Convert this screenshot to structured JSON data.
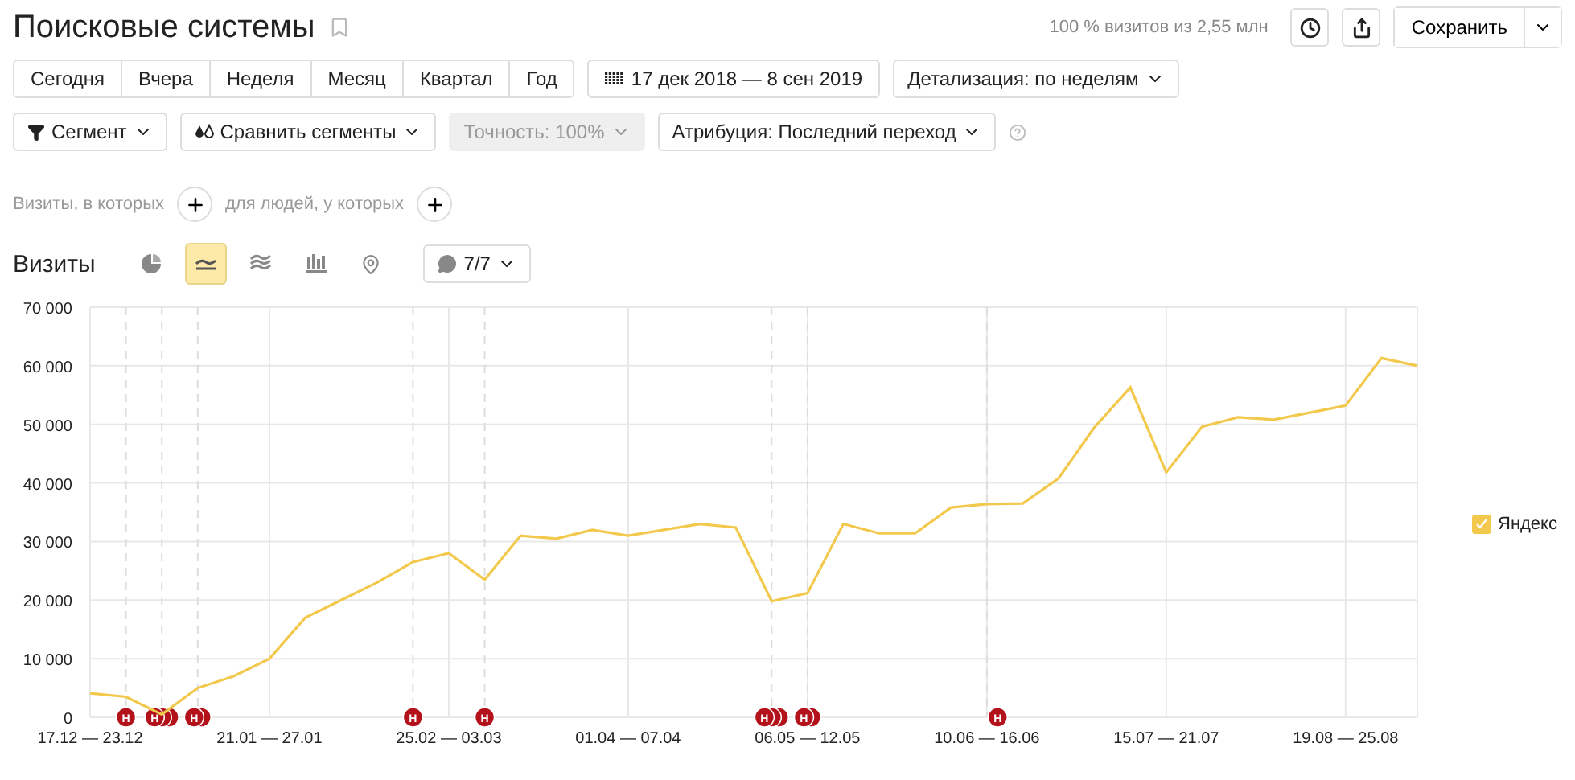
{
  "title": "Поисковые системы",
  "sample_info": "100 % визитов из 2,55 млн",
  "save_button": "Сохранить",
  "periods": [
    {
      "label": "Сегодня",
      "selected": false
    },
    {
      "label": "Вчера",
      "selected": false
    },
    {
      "label": "Неделя",
      "selected": false
    },
    {
      "label": "Месяц",
      "selected": false
    },
    {
      "label": "Квартал",
      "selected": false
    },
    {
      "label": "Год",
      "selected": false
    }
  ],
  "date_range": "17 дек 2018 — 8 сен 2019",
  "detail_dropdown": "Детализация: по неделям",
  "filters": [
    {
      "kind": "segment",
      "label": "Сегмент",
      "disabled": false
    },
    {
      "kind": "compare",
      "label": "Сравнить сегменты",
      "disabled": false
    },
    {
      "kind": "plain",
      "label": "Точность: 100%",
      "disabled": true
    },
    {
      "kind": "plain",
      "label": "Атрибуция: Последний переход",
      "disabled": false
    }
  ],
  "conditions": [
    {
      "label": "Визиты, в которых"
    },
    {
      "label": "для людей, у которых"
    }
  ],
  "metric_title": "Визиты",
  "chart_types": [
    {
      "kind": "pie",
      "selected": false
    },
    {
      "kind": "line",
      "selected": true
    },
    {
      "kind": "area",
      "selected": false
    },
    {
      "kind": "bar",
      "selected": false
    },
    {
      "kind": "map",
      "selected": false
    }
  ],
  "notes_dropdown": "7/7",
  "legend": [
    {
      "checked": true
    }
  ],
  "chart_data": {
    "type": "line",
    "categories": [
      "17.12 — 23.12",
      null,
      null,
      null,
      null,
      "21.01 — 27.01",
      null,
      null,
      null,
      null,
      "25.02 — 03.03",
      null,
      null,
      null,
      null,
      "01.04 — 07.04",
      null,
      null,
      null,
      null,
      "06.05 — 12.05",
      null,
      null,
      null,
      null,
      "10.06 — 16.06",
      null,
      null,
      null,
      null,
      "15.07 — 21.07",
      null,
      null,
      null,
      null,
      "19.08 — 25.08",
      null,
      null
    ],
    "series": [
      {
        "name": "Яндекс",
        "color": "#f2c94c",
        "values": [
          4100,
          3500,
          500,
          5000,
          7000,
          10000,
          17000,
          20000,
          23000,
          26500,
          28000,
          23500,
          31000,
          30500,
          32000,
          31000,
          32000,
          33000,
          32400,
          19800,
          21200,
          33000,
          31400,
          31400,
          35800,
          36400,
          36500,
          40800,
          49500,
          56300,
          41800,
          49600,
          51200,
          50800,
          52000,
          53200,
          61300,
          60000
        ]
      }
    ],
    "ylim": [
      0,
      70000
    ],
    "yticks": [
      {
        "value": 0,
        "label": "0"
      },
      {
        "value": 10000,
        "label": "10 000"
      },
      {
        "value": 20000,
        "label": "20 000"
      },
      {
        "value": 30000,
        "label": "30 000"
      },
      {
        "value": 40000,
        "label": "40 000"
      },
      {
        "value": 50000,
        "label": "50 000"
      },
      {
        "value": 60000,
        "label": "60 000"
      },
      {
        "value": 70000,
        "label": "70 000"
      }
    ],
    "grid": true
  },
  "note_groups": [
    {
      "text": "Н",
      "markers": [
        {
          "covered": false
        }
      ]
    },
    {
      "text": "Н",
      "markers": [
        {
          "covered": false
        },
        {
          "covered": true
        },
        {
          "covered": true
        }
      ]
    },
    {
      "text": "Н",
      "markers": [
        {
          "covered": false
        },
        {
          "covered": true
        }
      ]
    },
    {
      "text": "Н",
      "markers": [
        {
          "covered": false
        }
      ]
    },
    {
      "text": "Н",
      "markers": [
        {
          "covered": false
        }
      ]
    },
    {
      "text": "Н",
      "markers": [
        {
          "covered": false
        },
        {
          "covered": true
        },
        {
          "covered": true
        }
      ]
    },
    {
      "text": "Н",
      "markers": [
        {
          "covered": false
        },
        {
          "covered": true
        }
      ]
    },
    {
      "text": "Н",
      "markers": [
        {
          "covered": false
        }
      ]
    }
  ]
}
